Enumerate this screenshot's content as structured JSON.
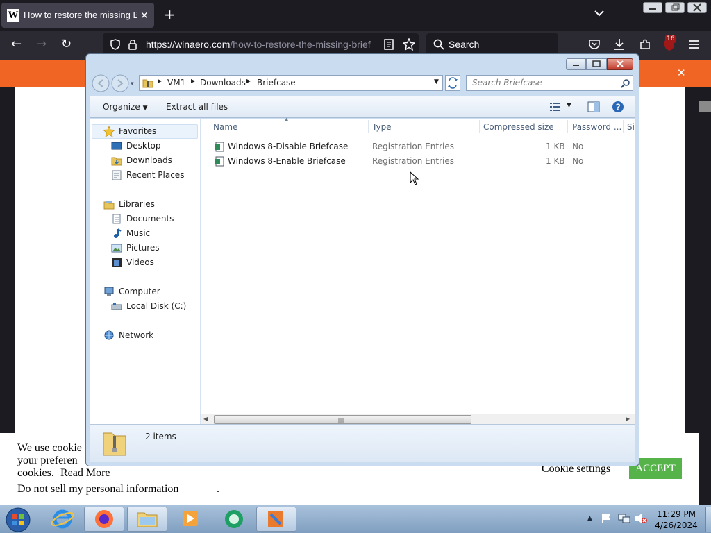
{
  "browser": {
    "tab_title": "How to restore the missing Brief",
    "url_host": "https://winaero.com",
    "url_path": "/how-to-restore-the-missing-brief",
    "search_placeholder": "Search",
    "extension_badge": "16"
  },
  "cookie_banner": {
    "line1": "We use cookie",
    "line2": "your preferen",
    "line3": "cookies.",
    "read_more": "Read More",
    "do_not_sell": "Do not sell my personal information",
    "settings": "Cookie settings",
    "accept": "ACCEPT"
  },
  "explorer": {
    "breadcrumb": [
      "VM1",
      "Downloads",
      "Briefcase"
    ],
    "search_placeholder": "Search Briefcase",
    "toolbar": {
      "organize": "Organize",
      "extract": "Extract all files"
    },
    "nav": {
      "favorites": "Favorites",
      "desktop": "Desktop",
      "downloads": "Downloads",
      "recent": "Recent Places",
      "libraries": "Libraries",
      "documents": "Documents",
      "music": "Music",
      "pictures": "Pictures",
      "videos": "Videos",
      "computer": "Computer",
      "local_disk": "Local Disk (C:)",
      "network": "Network"
    },
    "columns": {
      "name": "Name",
      "type": "Type",
      "compressed": "Compressed size",
      "password": "Password ...",
      "size": "Si"
    },
    "files": [
      {
        "name": "Windows 8-Disable Briefcase",
        "type": "Registration Entries",
        "size": "1 KB",
        "password": "No"
      },
      {
        "name": "Windows 8-Enable Briefcase",
        "type": "Registration Entries",
        "size": "1 KB",
        "password": "No"
      }
    ],
    "status": "2 items"
  },
  "taskbar": {
    "time": "11:29 PM",
    "date": "4/26/2024"
  }
}
